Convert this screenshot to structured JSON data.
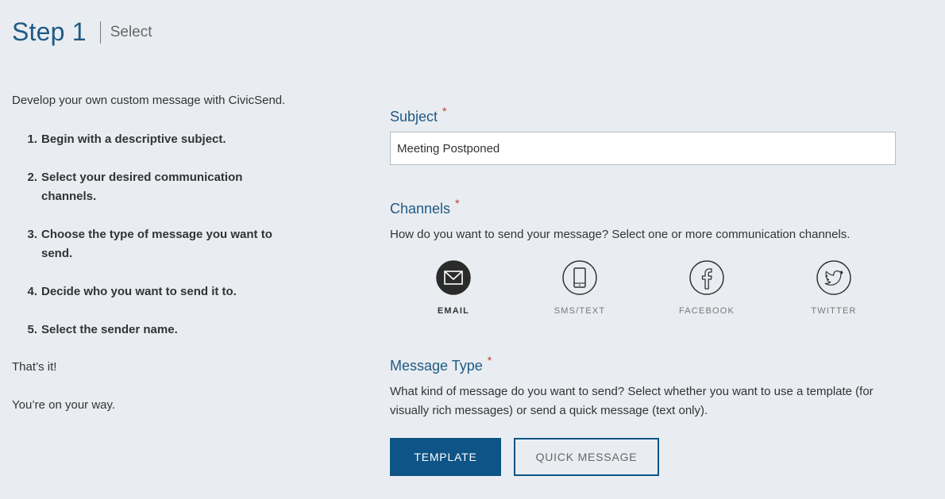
{
  "header": {
    "title": "Step 1",
    "subtitle": "Select"
  },
  "instructions": {
    "intro": "Develop your own custom message with CivicSend.",
    "steps": [
      {
        "num": "1.",
        "text": "Begin with a descriptive subject."
      },
      {
        "num": "2.",
        "text": "Select your desired communication channels."
      },
      {
        "num": "3.",
        "text": "Choose the type of message you want to send."
      },
      {
        "num": "4.",
        "text": "Decide who you want to send it to."
      },
      {
        "num": "5.",
        "text": "Select the sender name."
      }
    ],
    "outro1": "That’s it!",
    "outro2": "You’re on your way."
  },
  "subject": {
    "label": "Subject",
    "required": "*",
    "value": "Meeting Postponed"
  },
  "channels": {
    "label": "Channels",
    "required": "*",
    "description": "How do you want to send your message? Select one or more communication channels.",
    "items": [
      {
        "label": "EMAIL",
        "icon": "email-icon",
        "selected": true
      },
      {
        "label": "SMS/TEXT",
        "icon": "phone-icon",
        "selected": false
      },
      {
        "label": "FACEBOOK",
        "icon": "facebook-icon",
        "selected": false
      },
      {
        "label": "TWITTER",
        "icon": "twitter-icon",
        "selected": false
      }
    ]
  },
  "message_type": {
    "label": "Message Type",
    "required": "*",
    "description": "What kind of message do you want to send? Select whether you want to use a template (for visually rich messages) or send a quick message (text only).",
    "template_label": "TEMPLATE",
    "quick_label": "QUICK MESSAGE",
    "selected": "TEMPLATE"
  },
  "colors": {
    "accent": "#0e5486",
    "heading": "#1f5a85",
    "required": "#c0392b",
    "background": "#e9edf1"
  }
}
